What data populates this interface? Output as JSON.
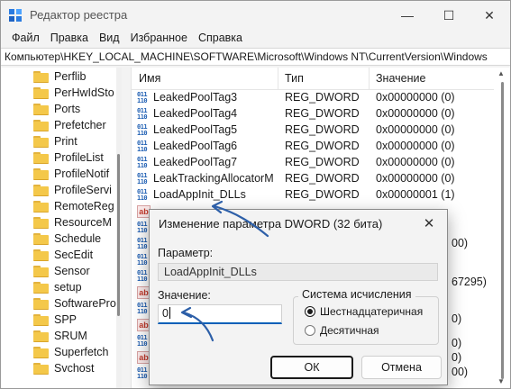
{
  "window": {
    "title": "Редактор реестра",
    "controls": {
      "minimize": "—",
      "maximize": "☐",
      "close": "✕"
    }
  },
  "menu": [
    "Файл",
    "Правка",
    "Вид",
    "Избранное",
    "Справка"
  ],
  "address": "Компьютер\\HKEY_LOCAL_MACHINE\\SOFTWARE\\Microsoft\\Windows NT\\CurrentVersion\\Windows",
  "tree": {
    "items": [
      "Perflib",
      "PerHwIdSto",
      "Ports",
      "Prefetcher",
      "Print",
      "ProfileList",
      "ProfileNotif",
      "ProfileServi",
      "RemoteReg",
      "ResourceM",
      "Schedule",
      "SecEdit",
      "Sensor",
      "setup",
      "SoftwarePro",
      "SPP",
      "SRUM",
      "Superfetch",
      "Svchost"
    ]
  },
  "list": {
    "headers": {
      "name": "Имя",
      "type": "Тип",
      "value": "Значение"
    },
    "rows": [
      {
        "icon": "binary",
        "name": "LeakedPoolTag3",
        "type": "REG_DWORD",
        "value": "0x00000000 (0)"
      },
      {
        "icon": "binary",
        "name": "LeakedPoolTag4",
        "type": "REG_DWORD",
        "value": "0x00000000 (0)"
      },
      {
        "icon": "binary",
        "name": "LeakedPoolTag5",
        "type": "REG_DWORD",
        "value": "0x00000000 (0)"
      },
      {
        "icon": "binary",
        "name": "LeakedPoolTag6",
        "type": "REG_DWORD",
        "value": "0x00000000 (0)"
      },
      {
        "icon": "binary",
        "name": "LeakedPoolTag7",
        "type": "REG_DWORD",
        "value": "0x00000000 (0)"
      },
      {
        "icon": "binary",
        "name": "LeakTrackingAllocatorM...",
        "type": "REG_DWORD",
        "value": "0x00000000 (0)"
      },
      {
        "icon": "binary",
        "name": "LoadAppInit_DLLs",
        "type": "REG_DWORD",
        "value": "0x00000001 (1)"
      }
    ],
    "hidden_rows_icons": [
      "string",
      "binary",
      "binary",
      "binary",
      "binary",
      "string",
      "binary",
      "string",
      "binary",
      "string",
      "binary"
    ],
    "partial_values": [
      "00)",
      "67295)",
      "0)",
      "0)",
      "0)",
      "00)"
    ]
  },
  "dialog": {
    "title": "Изменение параметра DWORD (32 бита)",
    "close": "✕",
    "param_label": "Параметр:",
    "param_value": "LoadAppInit_DLLs",
    "value_label": "Значение:",
    "value": "0",
    "base_group_title": "Система исчисления",
    "radio_hex": "Шестнадцатеричная",
    "radio_dec": "Десятичная",
    "selected_base": "hex",
    "ok": "ОК",
    "cancel": "Отмена"
  },
  "colors": {
    "accent": "#005fb8",
    "annotation_arrow": "#2d5fa8",
    "folder": "#f4c84a"
  }
}
